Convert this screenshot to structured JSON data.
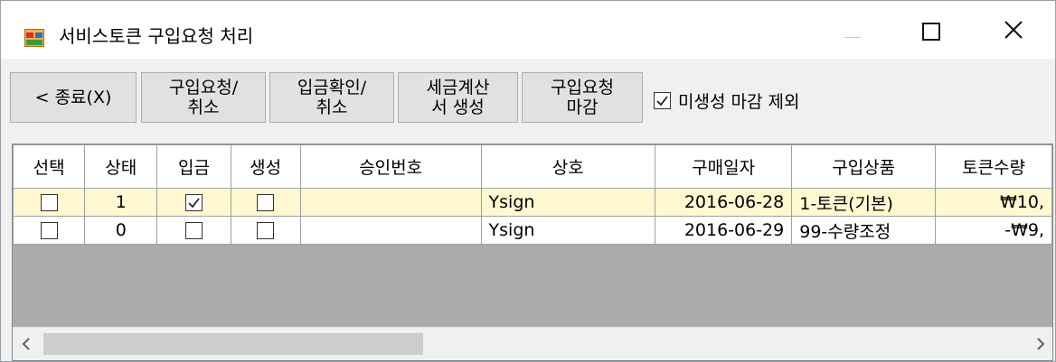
{
  "window": {
    "title": "서비스토큰 구입요청 처리"
  },
  "toolbar": {
    "close_label": "< 종료(X)",
    "request_cancel_line1": "구입요청/",
    "request_cancel_line2": "취소",
    "deposit_cancel_line1": "입금확인/",
    "deposit_cancel_line2": "취소",
    "tax_invoice_line1": "세금계산",
    "tax_invoice_line2": "서 생성",
    "request_deadline_line1": "구입요청",
    "request_deadline_line2": "마감",
    "exclude_checkbox_label": "미생성 마감 제외",
    "exclude_checked": true
  },
  "grid": {
    "columns": [
      "선택",
      "상태",
      "입금",
      "생성",
      "승인번호",
      "상호",
      "구매일자",
      "구입상품",
      "토큰수량"
    ],
    "rows": [
      {
        "select": false,
        "status": "1",
        "deposit": true,
        "created": false,
        "approval": "",
        "company": "Ysign",
        "date": "2016-06-28",
        "product": "1-토큰(기본)",
        "qty": "₩10,",
        "selected": true
      },
      {
        "select": false,
        "status": "0",
        "deposit": false,
        "created": false,
        "approval": "",
        "company": "Ysign",
        "date": "2016-06-29",
        "product": "99-수량조정",
        "qty": "-₩9,",
        "selected": false
      }
    ]
  },
  "icons": {
    "app": "form-window-icon",
    "minimize": "minimize-icon",
    "maximize": "maximize-icon",
    "close": "close-icon",
    "scroll_left": "chevron-left-icon",
    "scroll_right": "chevron-right-icon"
  }
}
